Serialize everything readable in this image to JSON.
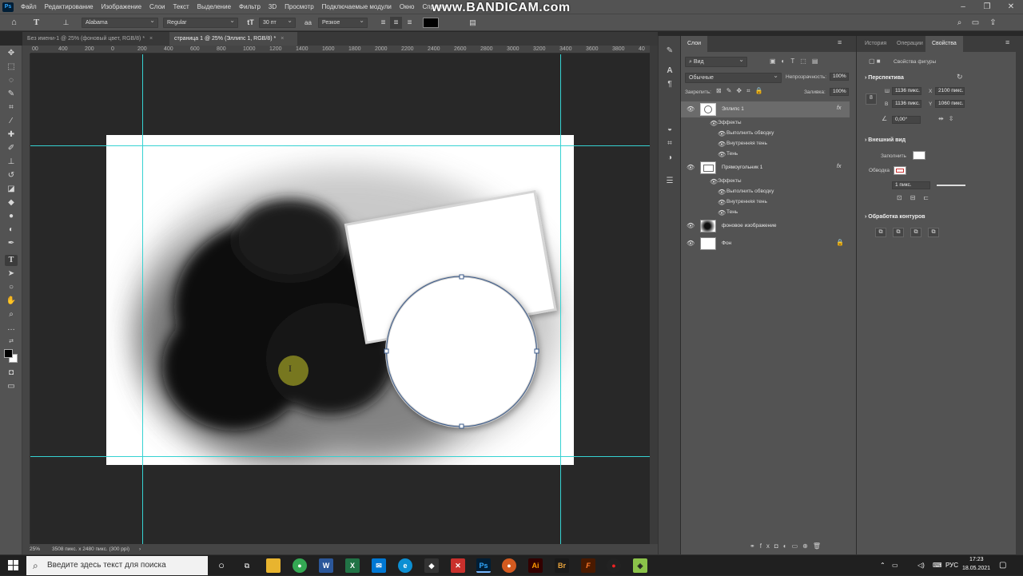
{
  "app": {
    "watermark": "www.BANDICAM.com"
  },
  "menu": [
    "Файл",
    "Редактирование",
    "Изображение",
    "Слои",
    "Текст",
    "Выделение",
    "Фильтр",
    "3D",
    "Просмотр",
    "Подключаемые модули",
    "Окно",
    "Справка"
  ],
  "options": {
    "font_family": "Alabama",
    "font_style": "Regular",
    "font_size": "30 пт",
    "antialias": "Резкое",
    "text_color": "#000000"
  },
  "tabs": [
    {
      "label": "Без имени-1 @ 25% (фоновый цвет, RGB/8) *",
      "close": "×"
    },
    {
      "label": "страница 1 @ 25% (Эллипс 1, RGB/8) *",
      "close": "×"
    }
  ],
  "ruler": {
    "top": [
      "00",
      "400",
      "200",
      "0",
      "200",
      "400",
      "600",
      "800",
      "1000",
      "1200",
      "1400",
      "1600",
      "1800",
      "2000",
      "2200",
      "2400",
      "2600",
      "2800",
      "3000",
      "3200",
      "3400",
      "3600",
      "3800",
      "40"
    ]
  },
  "status": {
    "zoom": "25%",
    "size": "3508 пикс. x 2480 пикс. (300 ppi)",
    "arrow": "›"
  },
  "layers_panel": {
    "tabs": [
      "Слои"
    ],
    "filter": "Вид",
    "blend": "Обычные",
    "opacity_label": "Непрозрачность:",
    "opacity": "100%",
    "lock_label": "Закрепить:",
    "fill_label": "Заливка:",
    "fill": "100%",
    "layers": [
      {
        "name": "Эллипс 1",
        "fx": "fx",
        "effects_label": "Эффекты",
        "effects": [
          "Выполнить обводку",
          "Внутренняя тень",
          "Тень"
        ]
      },
      {
        "name": "Прямоугольник 1",
        "fx": "fx",
        "effects_label": "Эффекты",
        "effects": [
          "Выполнить обводку",
          "Внутренняя тень",
          "Тень"
        ]
      },
      {
        "name": "фоновое изображение"
      },
      {
        "name": "Фон"
      }
    ]
  },
  "props_panel": {
    "tabs": [
      "История",
      "Операции",
      "Свойства"
    ],
    "header": "Свойства фигуры",
    "transform_title": "Перспектива",
    "w_label": "Ш",
    "w": "1136 пикс.",
    "x_label": "X",
    "x": "2100 пикс.",
    "h_label": "В",
    "h": "1136 пикс.",
    "y_label": "Y",
    "y": "1060 пикс.",
    "angle": "0,00°",
    "appearance_title": "Внешний вид",
    "fill_label": "Заполнить",
    "stroke_label": "Обводка",
    "stroke_width": "1 пикс.",
    "paths_title": "Обработка контуров"
  },
  "taskbar": {
    "search_placeholder": "Введите здесь текст для поиска",
    "lang": "РУС",
    "time": "17:23",
    "date": "18.05.2021"
  },
  "colors": {
    "guide": "#36d2d2",
    "ps_blue": "#31a8ff"
  }
}
